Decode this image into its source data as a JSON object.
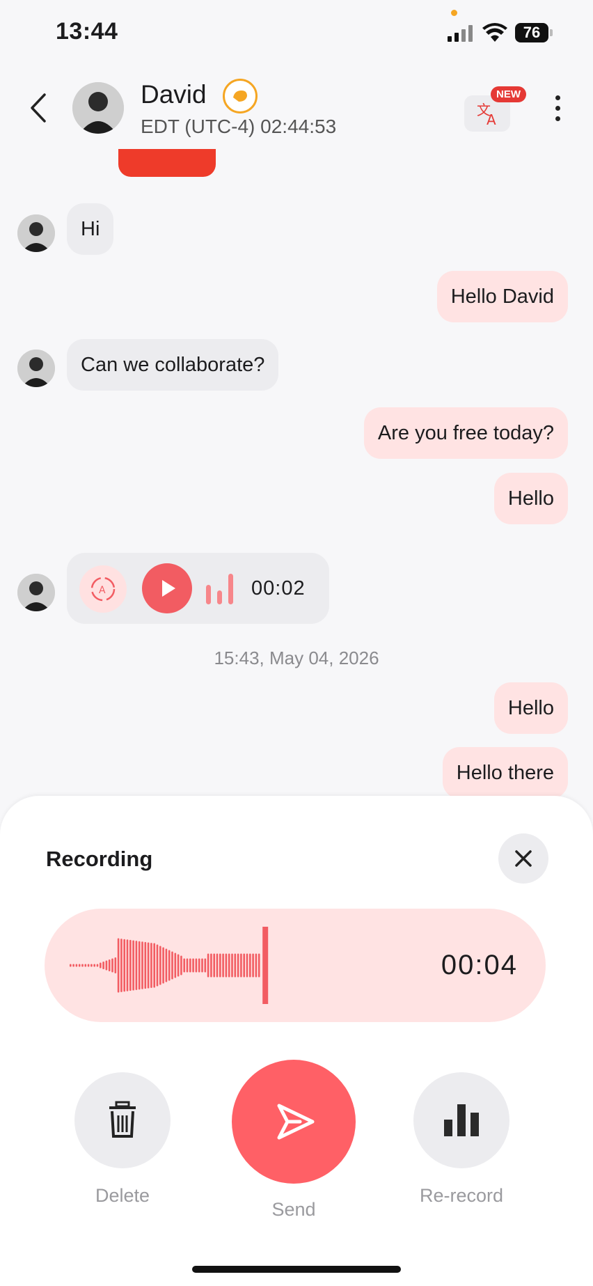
{
  "status_bar": {
    "time": "13:44",
    "battery": "76"
  },
  "header": {
    "name": "David",
    "timezone": "EDT (UTC-4) 02:44:53",
    "new_badge": "NEW",
    "icons": [
      "back-icon",
      "wave-hand-icon",
      "translate-icon",
      "more-icon"
    ]
  },
  "messages": [
    {
      "side": "in",
      "text": "Hi"
    },
    {
      "side": "out",
      "text": "Hello David"
    },
    {
      "side": "in",
      "text": "Can we collaborate?"
    },
    {
      "side": "out",
      "text": "Are you free today?"
    },
    {
      "side": "out",
      "text": "Hello"
    },
    {
      "side": "in",
      "type": "voice",
      "duration": "00:02"
    },
    {
      "side": "out",
      "text": "Hello"
    },
    {
      "side": "out",
      "text": "Hello there"
    }
  ],
  "timestamp": "15:43, May 04, 2026",
  "recording": {
    "title": "Recording",
    "duration": "00:04"
  },
  "actions": {
    "delete": "Delete",
    "send": "Send",
    "rerecord": "Re-record"
  },
  "colors": {
    "accent": "#ff6066",
    "bubble_out": "#ffe3e3",
    "bubble_in": "#ececef"
  }
}
